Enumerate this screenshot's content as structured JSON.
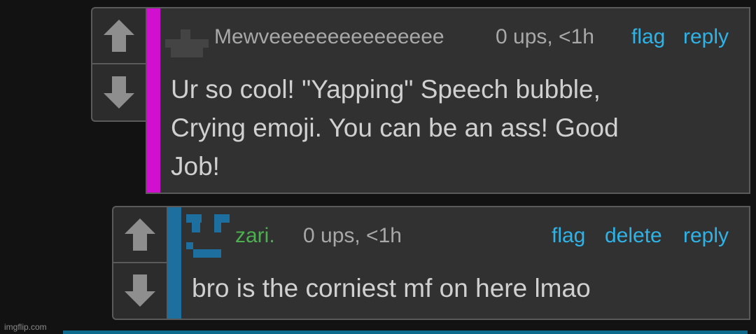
{
  "comments": [
    {
      "username": "Mewveeeeeeeeeeeeeee",
      "meta": "0 ups, <1h",
      "actions": {
        "flag": "flag",
        "reply": "reply"
      },
      "text_lines": [
        "Ur so cool! \"Yapping\" Speech bubble,",
        "Crying emoji. You can be an ass! Good",
        "Job!"
      ],
      "accent_color": "#d10fcf"
    },
    {
      "username": "zari.",
      "meta": "0 ups, <1h",
      "actions": {
        "flag": "flag",
        "delete": "delete",
        "reply": "reply"
      },
      "text_lines": [
        "bro is the corniest mf on here lmao"
      ],
      "accent_color": "#1d6fa0",
      "username_color": "#4caf50"
    }
  ],
  "watermark": "imgflip.com",
  "colors": {
    "link": "#2fb3e6",
    "text": "#d0d0d0",
    "meta": "#a8a8a8"
  }
}
